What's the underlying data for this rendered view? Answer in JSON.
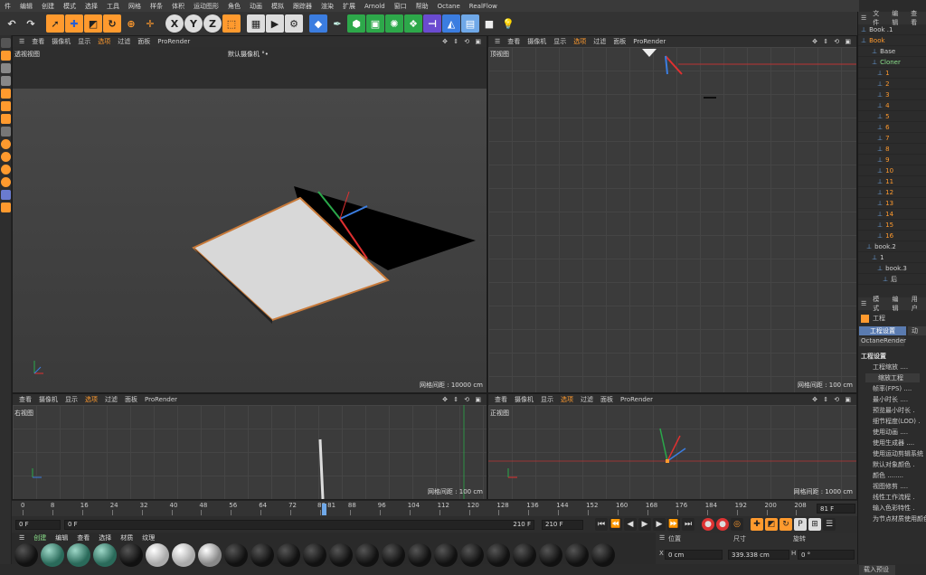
{
  "menu": [
    "件",
    "编辑",
    "创建",
    "模式",
    "选择",
    "工具",
    "网格",
    "样条",
    "体积",
    "运动图形",
    "角色",
    "动画",
    "模拟",
    "跟踪器",
    "渲染",
    "扩展",
    "Arnold",
    "窗口",
    "帮助",
    "Octane",
    "RealFlow"
  ],
  "viewport_menu": [
    "查看",
    "摄像机",
    "显示",
    "选项",
    "过滤",
    "面板",
    "ProRender"
  ],
  "viewports": {
    "perspective": {
      "name": "透视视图",
      "camera": "默认摄像机 °•",
      "grid": "网格间距 : 10000 cm"
    },
    "top": {
      "name": "顶视图",
      "grid": "网格间距 : 100 cm"
    },
    "right": {
      "name": "右视图",
      "grid": "网格间距 : 100 cm"
    },
    "front": {
      "name": "正视图",
      "grid": "网格间距 : 1000 cm"
    }
  },
  "timeline": {
    "ticks": [
      "0",
      "8",
      "16",
      "24",
      "32",
      "40",
      "48",
      "56",
      "64",
      "72",
      "80",
      "88",
      "96",
      "104",
      "112",
      "120",
      "128",
      "136",
      "144",
      "152",
      "160",
      "168",
      "176",
      "184",
      "192",
      "200",
      "208"
    ],
    "playhead_label": "80 81",
    "current_frame": "81 F",
    "start": "0 F",
    "range_start": "0 F",
    "range_end": "210 F",
    "end": "210 F"
  },
  "material_menu": [
    "创建",
    "编辑",
    "查看",
    "选择",
    "材质",
    "纹理"
  ],
  "coords": {
    "header": [
      "位置",
      "尺寸",
      "旋转"
    ],
    "x_label": "X",
    "x_val": "0 cm",
    "size_val": "339.338 cm",
    "h_label": "H",
    "h_val": "0 °"
  },
  "object_manager": {
    "menu": [
      "文件",
      "编辑",
      "查看"
    ],
    "objects": [
      {
        "name": "Book .1",
        "indent": 0,
        "color": "#cfcfcf"
      },
      {
        "name": "Book",
        "indent": 0,
        "color": "#ff9a2e"
      },
      {
        "name": "Base",
        "indent": 2,
        "color": "#cfcfcf"
      },
      {
        "name": "Cloner",
        "indent": 2,
        "color": "#8be08b"
      },
      {
        "name": "1",
        "indent": 3,
        "color": "#ff9a2e"
      },
      {
        "name": "2",
        "indent": 3,
        "color": "#ff9a2e"
      },
      {
        "name": "3",
        "indent": 3,
        "color": "#ff9a2e"
      },
      {
        "name": "4",
        "indent": 3,
        "color": "#ff9a2e"
      },
      {
        "name": "5",
        "indent": 3,
        "color": "#ff9a2e"
      },
      {
        "name": "6",
        "indent": 3,
        "color": "#ff9a2e"
      },
      {
        "name": "7",
        "indent": 3,
        "color": "#ff9a2e"
      },
      {
        "name": "8",
        "indent": 3,
        "color": "#ff9a2e"
      },
      {
        "name": "9",
        "indent": 3,
        "color": "#ff9a2e"
      },
      {
        "name": "10",
        "indent": 3,
        "color": "#ff9a2e"
      },
      {
        "name": "11",
        "indent": 3,
        "color": "#ff9a2e"
      },
      {
        "name": "12",
        "indent": 3,
        "color": "#ff9a2e"
      },
      {
        "name": "13",
        "indent": 3,
        "color": "#ff9a2e"
      },
      {
        "name": "14",
        "indent": 3,
        "color": "#ff9a2e"
      },
      {
        "name": "15",
        "indent": 3,
        "color": "#ff9a2e"
      },
      {
        "name": "16",
        "indent": 3,
        "color": "#ff9a2e"
      },
      {
        "name": "book.2",
        "indent": 1,
        "color": "#cfcfcf"
      },
      {
        "name": "1",
        "indent": 2,
        "color": "#cfcfcf"
      },
      {
        "name": "book.3",
        "indent": 3,
        "color": "#cfcfcf"
      },
      {
        "name": "后",
        "indent": 4,
        "color": "#cfcfcf"
      }
    ]
  },
  "attributes": {
    "menu": [
      "模式",
      "编辑",
      "用户"
    ],
    "title": "工程",
    "tabs": [
      "工程设置",
      "动"
    ],
    "octane_tab": "OctaneRender",
    "section": "工程设置",
    "rows": [
      "工程缩放 ....",
      "帧率(FPS) ....",
      "最小时长 ....",
      "预览最小时长 .",
      "细节程度(LOD) .",
      "使用动画 ....",
      "使用生成器 ....",
      "使用运动剪辑系统",
      "默认对象颜色 .",
      "颜色 ........",
      "视图修剪 ....",
      "线性工作流程 .",
      "输入色彩特性 .",
      "为节点材质使用颜色"
    ],
    "scale_button": "缩放工程",
    "bottom_button": "载入预设"
  }
}
